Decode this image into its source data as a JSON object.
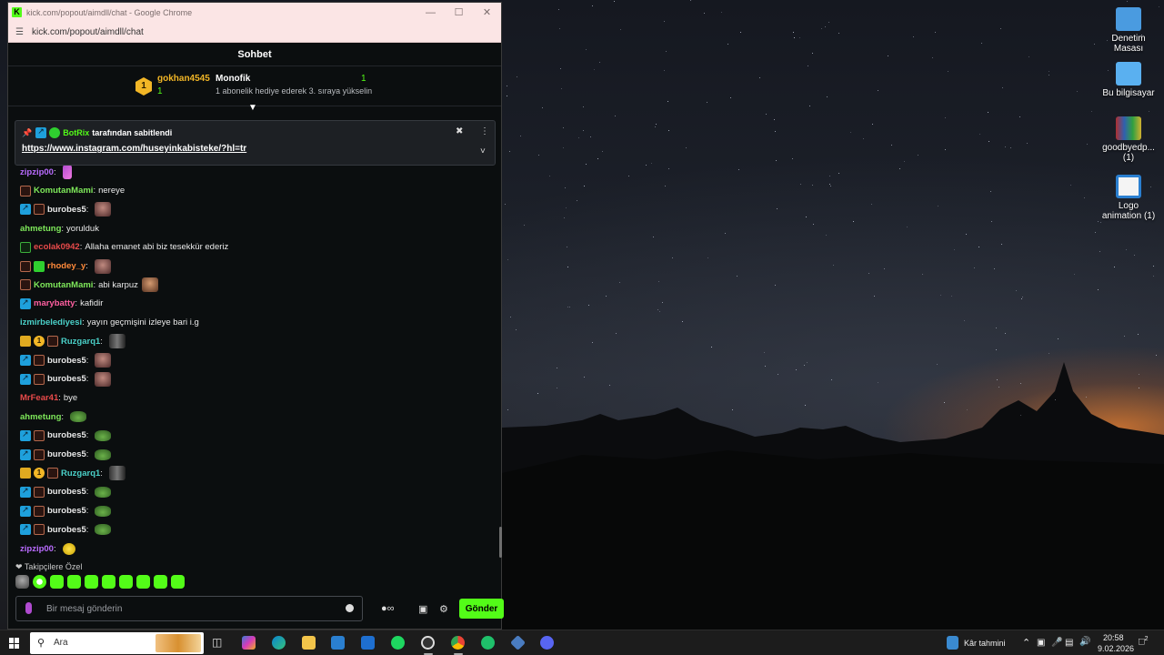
{
  "window": {
    "title": "kick.com/popout/aimdll/chat - Google Chrome",
    "url": "kick.com/popout/aimdll/chat",
    "logo_letter": "K"
  },
  "chat": {
    "header": "Sohbet",
    "leaderboard": {
      "rank": "1",
      "top_user": "gokhan4545",
      "top_count": "1",
      "gift_user": "Monofik",
      "gift_hint": "1 abonelik hediye ederek 3. sıraya yükselin",
      "right_count": "1"
    },
    "pinned": {
      "by": "BotRix",
      "text": "tarafından sabitlendi",
      "link": "https://www.instagram.com/huseyinkabisteke/?hl=tr"
    },
    "messages": [
      {
        "user": "zipzip00",
        "color": "#b96bff",
        "text": "",
        "badges": [],
        "emote": "e-pink"
      },
      {
        "user": "KomutanMami",
        "color": "#7ee85a",
        "text": "nereye",
        "badges": [
          "b-sub"
        ],
        "emote": ""
      },
      {
        "user": "burobes5",
        "color": "#e8e8e8",
        "text": "",
        "badges": [
          "b-mod",
          "b-sub"
        ],
        "emote": "e-face"
      },
      {
        "user": "ahmetung",
        "color": "#7ee85a",
        "text": "yorulduk",
        "badges": [],
        "emote": ""
      },
      {
        "user": "ecolak0942",
        "color": "#e84a4a",
        "text": "Allaha emanet abi biz tesekkür ederiz",
        "badges": [
          "b-subg"
        ],
        "emote": ""
      },
      {
        "user": "rhodey_y",
        "color": "#ff8a3a",
        "text": "",
        "badges": [
          "b-sub",
          "b-gift"
        ],
        "emote": "e-face"
      },
      {
        "user": "KomutanMami",
        "color": "#7ee85a",
        "text": "abi karpuz",
        "badges": [
          "b-sub"
        ],
        "emote": "e-man"
      },
      {
        "user": "marybatty",
        "color": "#ff5fa0",
        "text": "kafidir",
        "badges": [
          "b-mod"
        ],
        "emote": ""
      },
      {
        "user": "izmirbelediyesi",
        "color": "#4ad0c8",
        "text": "yayın geçmişini izleye bari i.g",
        "badges": [],
        "emote": ""
      },
      {
        "user": "Ruzgarq1",
        "color": "#4ad0c8",
        "text": "",
        "badges": [
          "b-vip",
          "b-gold",
          "b-sub"
        ],
        "emote": "e-dark"
      },
      {
        "user": "burobes5",
        "color": "#e8e8e8",
        "text": "",
        "badges": [
          "b-mod",
          "b-sub"
        ],
        "emote": "e-face"
      },
      {
        "user": "burobes5",
        "color": "#e8e8e8",
        "text": "",
        "badges": [
          "b-mod",
          "b-sub"
        ],
        "emote": "e-face"
      },
      {
        "user": "MrFear41",
        "color": "#e84a4a",
        "text": "bye",
        "badges": [],
        "emote": ""
      },
      {
        "user": "ahmetung",
        "color": "#7ee85a",
        "text": "",
        "badges": [],
        "emote": "e-frog"
      },
      {
        "user": "burobes5",
        "color": "#e8e8e8",
        "text": "",
        "badges": [
          "b-mod",
          "b-sub"
        ],
        "emote": "e-frog"
      },
      {
        "user": "burobes5",
        "color": "#e8e8e8",
        "text": "",
        "badges": [
          "b-mod",
          "b-sub"
        ],
        "emote": "e-frog"
      },
      {
        "user": "Ruzgarq1",
        "color": "#4ad0c8",
        "text": "",
        "badges": [
          "b-vip",
          "b-gold",
          "b-sub"
        ],
        "emote": "e-dark"
      },
      {
        "user": "burobes5",
        "color": "#e8e8e8",
        "text": "",
        "badges": [
          "b-mod",
          "b-sub"
        ],
        "emote": "e-frog"
      },
      {
        "user": "burobes5",
        "color": "#e8e8e8",
        "text": "",
        "badges": [
          "b-mod",
          "b-sub"
        ],
        "emote": "e-frog"
      },
      {
        "user": "burobes5",
        "color": "#e8e8e8",
        "text": "",
        "badges": [
          "b-mod",
          "b-sub"
        ],
        "emote": "e-frog"
      },
      {
        "user": "zipzip00",
        "color": "#b96bff",
        "text": "",
        "badges": [],
        "emote": "e-yellow"
      }
    ],
    "followers_label": "Takipçilere Özel",
    "input_placeholder": "Bir mesaj gönderin",
    "send_label": "Gönder"
  },
  "desktop_icons": [
    {
      "label": "Denetim Masası",
      "color": "#4a9be0",
      "icon": "control-panel-icon"
    },
    {
      "label": "Bu bilgisayar",
      "color": "#5ab0f0",
      "icon": "computer-icon"
    },
    {
      "label": "goodbyedp... (1)",
      "color": "#b8a030",
      "icon": "archive-icon"
    },
    {
      "label": "Logo animation (1)",
      "color": "#2a7fd0",
      "icon": "video-file-icon"
    }
  ],
  "taskbar": {
    "search_placeholder": "Ara",
    "weather": "Kâr tahmini",
    "time": "20:58",
    "date": "9.02.2026",
    "notification_count": "2"
  }
}
